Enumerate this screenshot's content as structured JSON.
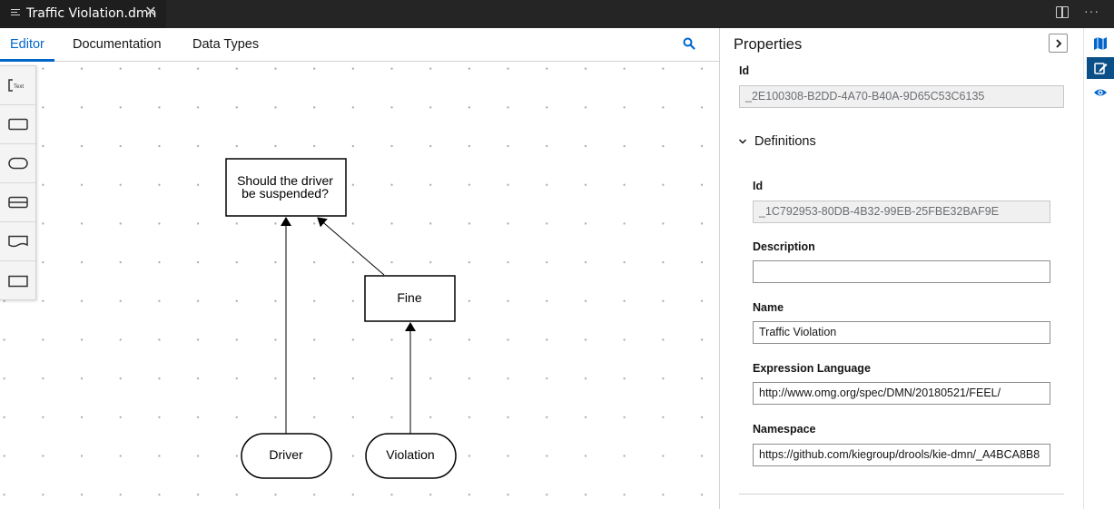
{
  "window": {
    "tab_title": "Traffic Violation.dmn",
    "close_glyph": "✕",
    "more_glyph": "···"
  },
  "editor_tabs": [
    {
      "label": "Editor",
      "active": true
    },
    {
      "label": "Documentation",
      "active": false
    },
    {
      "label": "Data Types",
      "active": false
    }
  ],
  "palette": {
    "tools": [
      "text-annotation-tool",
      "decision-tool",
      "input-data-tool",
      "business-knowledge-model-tool",
      "knowledge-source-tool",
      "decision-service-tool"
    ]
  },
  "diagram": {
    "nodes": [
      {
        "id": "decision",
        "type": "decision",
        "lines": [
          "Should the driver",
          "be suspended?"
        ]
      },
      {
        "id": "fine",
        "type": "decision",
        "lines": [
          "Fine"
        ]
      },
      {
        "id": "driver",
        "type": "input-data",
        "lines": [
          "Driver"
        ]
      },
      {
        "id": "violation",
        "type": "input-data",
        "lines": [
          "Violation"
        ]
      }
    ],
    "edges": [
      {
        "from": "driver",
        "to": "decision"
      },
      {
        "from": "fine",
        "to": "decision"
      },
      {
        "from": "violation",
        "to": "fine"
      }
    ]
  },
  "properties": {
    "title": "Properties",
    "id_label": "Id",
    "id_value": "_2E100308-B2DD-4A70-B40A-9D65C53C6135",
    "section_title": "Definitions",
    "def_id_label": "Id",
    "def_id_value": "_1C792953-80DB-4B32-99EB-25FBE32BAF9E",
    "description_label": "Description",
    "description_value": "",
    "name_label": "Name",
    "name_value": "Traffic Violation",
    "expression_language_label": "Expression Language",
    "expression_language_value": "http://www.omg.org/spec/DMN/20180521/FEEL/",
    "namespace_label": "Namespace",
    "namespace_value": "https://github.com/kiegroup/drools/kie-dmn/_A4BCA8B8"
  },
  "colors": {
    "accent": "#0066cc",
    "rail_active": "#0b4f89",
    "titlebar": "#252526"
  }
}
